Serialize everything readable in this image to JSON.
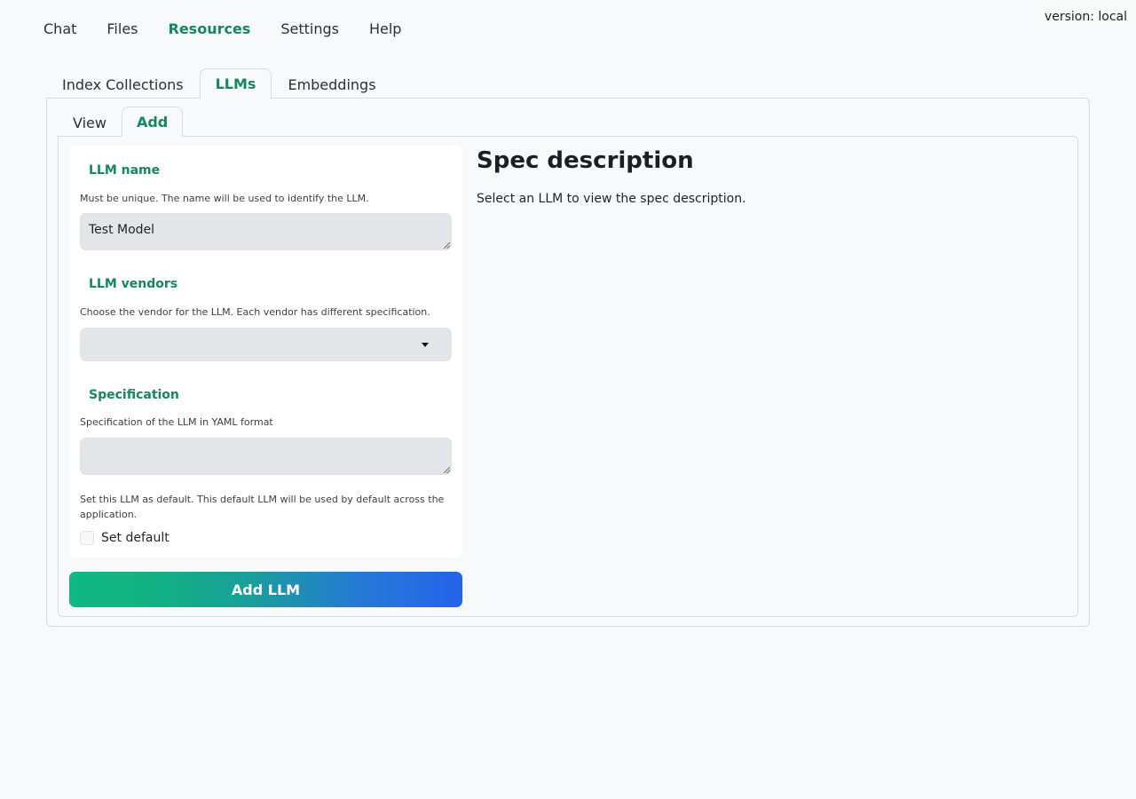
{
  "header": {
    "version": "version: local",
    "nav": [
      {
        "label": "Chat",
        "active": false
      },
      {
        "label": "Files",
        "active": false
      },
      {
        "label": "Resources",
        "active": true
      },
      {
        "label": "Settings",
        "active": false
      },
      {
        "label": "Help",
        "active": false
      }
    ]
  },
  "resource_tabs": [
    {
      "label": "Index Collections",
      "active": false
    },
    {
      "label": "LLMs",
      "active": true
    },
    {
      "label": "Embeddings",
      "active": false
    }
  ],
  "llm_tabs": [
    {
      "label": "View",
      "active": false
    },
    {
      "label": "Add",
      "active": true
    }
  ],
  "form": {
    "name": {
      "label": "LLM name",
      "info": "Must be unique. The name will be used to identify the LLM.",
      "value": "Test Model"
    },
    "vendor": {
      "label": "LLM vendors",
      "info": "Choose the vendor for the LLM. Each vendor has different specification.",
      "value": ""
    },
    "spec": {
      "label": "Specification",
      "info": "Specification of the LLM in YAML format",
      "value": ""
    },
    "default": {
      "info": "Set this LLM as default. This default LLM will be used by default across the application.",
      "label": "Set default",
      "checked": false
    },
    "submit_label": "Add LLM"
  },
  "spec_panel": {
    "title": "Spec description",
    "text": "Select an LLM to view the spec description."
  },
  "colors": {
    "accent": "#13885e",
    "button_gradient_start": "#10b981",
    "button_gradient_end": "#2563eb"
  }
}
